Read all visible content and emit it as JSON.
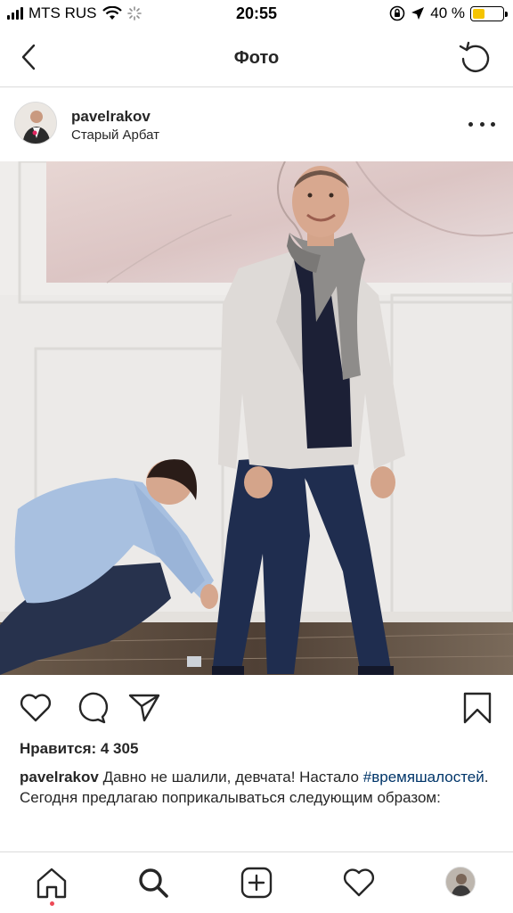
{
  "status_bar": {
    "carrier": "MTS RUS",
    "time": "20:55",
    "battery_percent": "40 %",
    "battery_level": 0.4
  },
  "nav": {
    "title": "Фото",
    "back_icon": "chevron-left-icon",
    "refresh_icon": "refresh-icon"
  },
  "post": {
    "username": "pavelrakov",
    "location": "Старый Арбат",
    "likes_label": "Нравится: 4 305",
    "caption": {
      "username": "pavelrakov",
      "text_before": "Давно не шалили, девчата! Настало",
      "hashtag": "#времяшалостей",
      "text_after": ". Сегодня предлагаю поприкалываться следующим образом:"
    }
  },
  "actions": {
    "like_icon": "heart-icon",
    "comment_icon": "comment-icon",
    "share_icon": "send-icon",
    "save_icon": "bookmark-icon"
  },
  "tabbar": {
    "items": [
      "home-icon",
      "search-icon",
      "add-icon",
      "activity-icon",
      "profile-avatar"
    ]
  },
  "colors": {
    "text": "#262626",
    "hashtag": "#003569",
    "divider": "#dbdbdb",
    "notification_dot": "#ed4956",
    "battery": "#f5c400"
  }
}
